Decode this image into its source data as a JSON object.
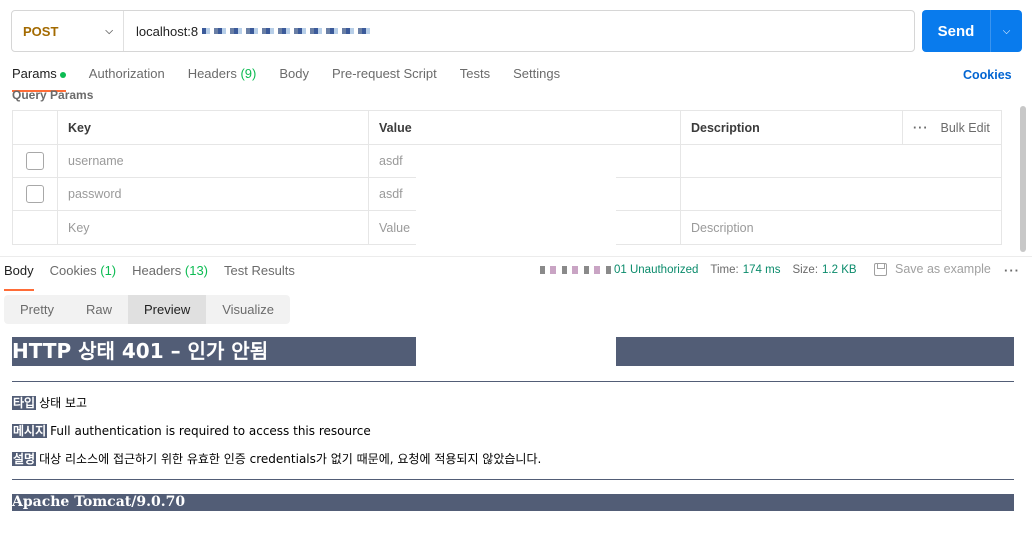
{
  "request": {
    "method": "POST",
    "url_prefix": "localhost:8",
    "send_label": "Send"
  },
  "req_tabs": [
    {
      "label": "Params",
      "active": true
    },
    {
      "label": "Authorization"
    },
    {
      "label": "Headers",
      "count": "(9)"
    },
    {
      "label": "Body"
    },
    {
      "label": "Pre-request Script"
    },
    {
      "label": "Tests"
    },
    {
      "label": "Settings"
    }
  ],
  "cookies_label": "Cookies",
  "query_params_title": "Query Params",
  "params_table": {
    "headers": [
      "Key",
      "Value",
      "Description"
    ],
    "bulk_edit": "Bulk Edit",
    "rows": [
      {
        "key": "username",
        "value": "asdf",
        "description": ""
      },
      {
        "key": "password",
        "value": "asdf",
        "description": ""
      }
    ],
    "placeholder": {
      "key": "Key",
      "value": "Value",
      "description": "Description"
    }
  },
  "res_tabs": [
    {
      "label": "Body",
      "active": true
    },
    {
      "label": "Cookies",
      "count": "(1)"
    },
    {
      "label": "Headers",
      "count": "(13)"
    },
    {
      "label": "Test Results"
    }
  ],
  "status": {
    "code_text": "01 Unauthorized",
    "time_label": "Time:",
    "time_value": "174 ms",
    "size_label": "Size:",
    "size_value": "1.2 KB"
  },
  "save_example": "Save as example",
  "view_tabs": [
    {
      "label": "Pretty"
    },
    {
      "label": "Raw"
    },
    {
      "label": "Preview",
      "active": true
    },
    {
      "label": "Visualize"
    }
  ],
  "preview": {
    "title": "HTTP 상태 401 – 인가 안됨",
    "lines": [
      {
        "label": "타입",
        "text": "상태 보고"
      },
      {
        "label": "메시지",
        "text": "Full authentication is required to access this resource"
      },
      {
        "label": "설명",
        "text": "대상 리소스에 접근하기 위한 유효한 인증 credentials가 없기 때문에, 요청에 적용되지 않았습니다."
      }
    ],
    "footer": "Apache Tomcat/9.0.70"
  },
  "colors": {
    "accent": "#ff6c37",
    "send": "#097bed",
    "tomcat_header": "#525d76",
    "success": "#0cbb52"
  }
}
